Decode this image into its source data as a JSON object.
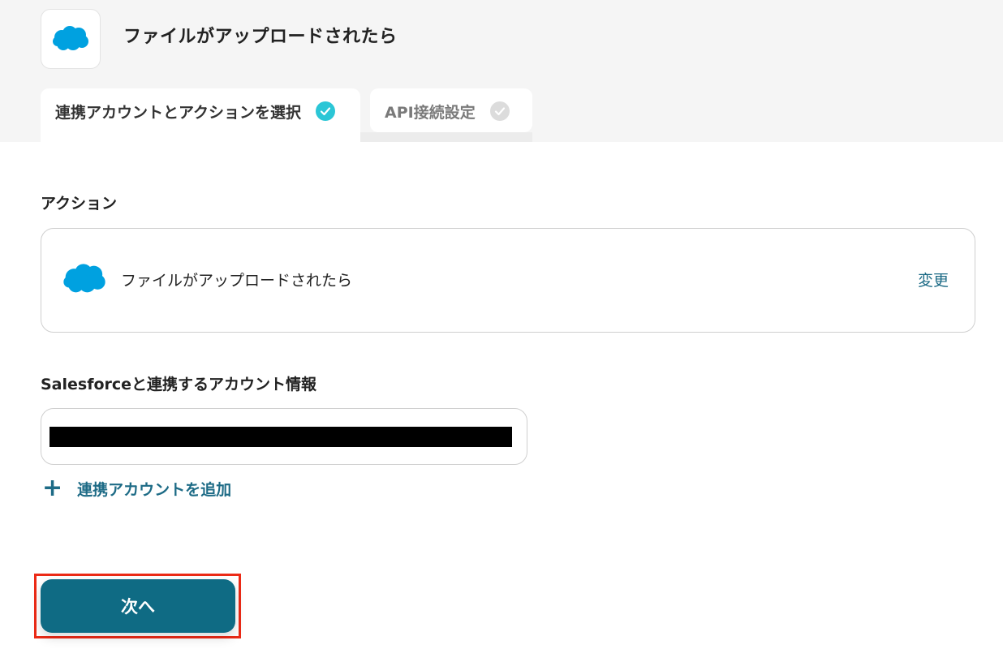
{
  "header": {
    "title": "ファイルがアップロードされたら",
    "app_icon": "salesforce-cloud-icon",
    "brand_color": "#00a1e0"
  },
  "tabs": [
    {
      "label": "連携アカウントとアクションを選択",
      "state": "active",
      "completed": true
    },
    {
      "label": "API接続設定",
      "state": "inactive",
      "completed": false
    }
  ],
  "action": {
    "section_label": "アクション",
    "name": "ファイルがアップロードされたら",
    "change_label": "変更"
  },
  "account": {
    "section_label": "Salesforceと連携するアカウント情報",
    "add_label": "連携アカウントを追加"
  },
  "footer": {
    "next_label": "次へ",
    "button_color": "#0f6b84",
    "highlight_color": "#ec2a16"
  },
  "colors": {
    "accent_link": "#1d6b86",
    "check_complete": "#2bc6d6",
    "check_pending": "#dcdcdc"
  }
}
